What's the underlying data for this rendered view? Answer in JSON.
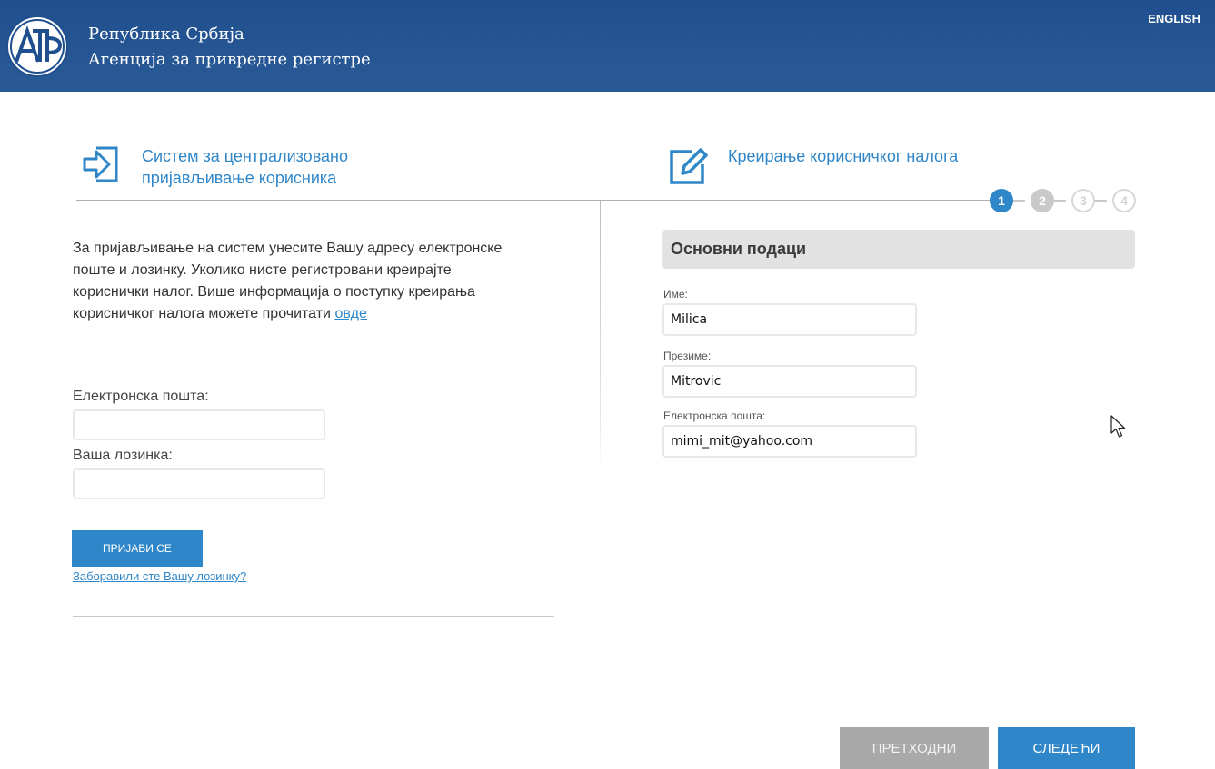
{
  "header": {
    "org_line1": "Република Србија",
    "org_line2": "Агенција за привредне регистре",
    "language_link": "ENGLISH",
    "logo_text": "АПР",
    "background_color": "#1f4f8e"
  },
  "left_section": {
    "title": "Систем за централизовано пријављивање корисника",
    "icon": "sign-in-arrow-icon",
    "intro_text": "За пријављивање на систем унесите Вашу адресу електронске поште и лозинку. Уколико нисте регистровани креирајте кориснички налог. Више информација о поступку креирања корисничког налога можете прочитати ",
    "intro_link": "овде",
    "email_label": "Електронска пошта:",
    "email_value": "",
    "password_label": "Ваша лозинка:",
    "password_value": "",
    "login_button": "ПРИЈАВИ СЕ",
    "forgot_link": "Заборавили сте Вашу лозинку?"
  },
  "right_section": {
    "title": "Креирање корисничког налога",
    "icon": "edit-pencil-icon",
    "steps": [
      {
        "label": "1",
        "state": "active"
      },
      {
        "label": "2",
        "state": "upcoming"
      },
      {
        "label": "3",
        "state": "inactive"
      },
      {
        "label": "4",
        "state": "inactive"
      }
    ],
    "form_heading": "Основни подаци",
    "first_name_label": "Име:",
    "first_name_value": "Milica",
    "last_name_label": "Презиме:",
    "last_name_value": "Mitrovic",
    "email_label": "Електронска пошта:",
    "email_value": "mimi_mit@yahoo.com"
  },
  "footer_buttons": {
    "previous": "ПРЕТХОДНИ",
    "next": "СЛЕДЕЋИ"
  },
  "colors": {
    "accent": "#2f86c8",
    "disabled": "#a9a9a9",
    "step_active": "#2f86c8",
    "step_upcoming": "#c4c4c4",
    "step_inactive": "#e6e6e6"
  }
}
